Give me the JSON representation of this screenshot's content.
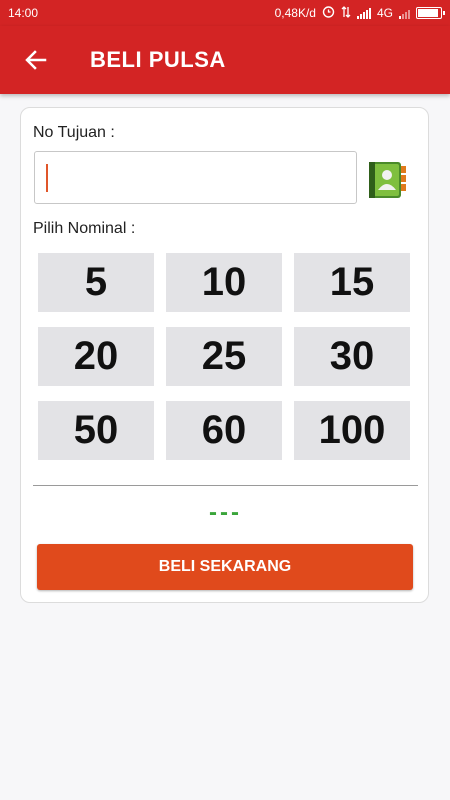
{
  "status_bar": {
    "time": "14:00",
    "net_speed": "0,48K/d",
    "network": "4G"
  },
  "app_bar": {
    "title": "BELI PULSA",
    "back_icon": "arrow-left-icon"
  },
  "form": {
    "destination_label": "No Tujuan :",
    "destination_value": "",
    "contact_icon": "address-book-icon",
    "nominal_label": "Pilih Nominal :",
    "nominals": [
      "5",
      "10",
      "15",
      "20",
      "25",
      "30",
      "50",
      "60",
      "100"
    ],
    "price_text": "---",
    "buy_label": "BELI SEKARANG"
  },
  "colors": {
    "primary": "#d32424",
    "buy_button": "#e04a1c",
    "price": "#3aa53a",
    "nominal_bg": "#e3e3e6"
  }
}
